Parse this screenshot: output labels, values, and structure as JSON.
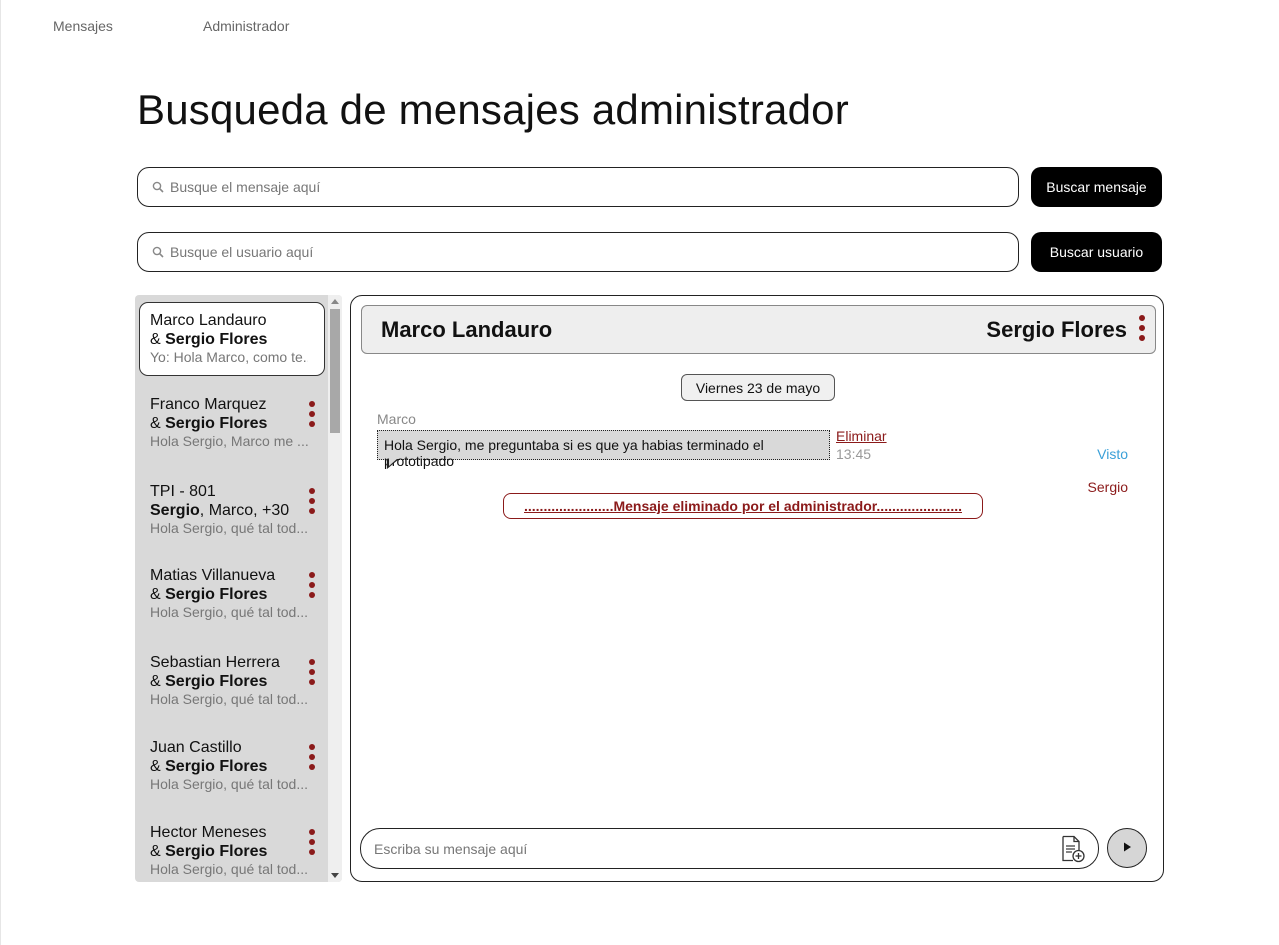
{
  "nav": {
    "mensajes": "Mensajes",
    "administrador": "Administrador"
  },
  "page_title": "Busqueda de mensajes administrador",
  "search_message": {
    "placeholder": "Busque el mensaje aquí",
    "button": "Buscar mensaje"
  },
  "search_user": {
    "placeholder": "Busque el usuario aquí",
    "button": "Buscar usuario"
  },
  "conversations": [
    {
      "l1": "Marco Landauro",
      "amp": "& ",
      "bold": "Sergio Flores",
      "preview": "Yo: Hola Marco, como te..."
    },
    {
      "l1": "Franco Marquez",
      "amp": "& ",
      "bold": "Sergio Flores",
      "preview": "Hola Sergio, Marco me ..."
    },
    {
      "l1": "TPI - 801",
      "bold": "Sergio",
      "rest": ", Marco, +30",
      "preview": "Hola Sergio, qué tal tod..."
    },
    {
      "l1": "Matias Villanueva",
      "amp": "& ",
      "bold": "Sergio Flores",
      "preview": "Hola Sergio, qué tal tod..."
    },
    {
      "l1": "Sebastian Herrera",
      "amp": "& ",
      "bold": "Sergio Flores",
      "preview": "Hola Sergio, qué tal tod..."
    },
    {
      "l1": "Juan Castillo",
      "amp": "& ",
      "bold": "Sergio Flores",
      "preview": "Hola Sergio, qué tal tod..."
    },
    {
      "l1": "Hector Meneses",
      "amp": "& ",
      "bold": "Sergio Flores",
      "preview": "Hola Sergio, qué tal tod..."
    }
  ],
  "chat": {
    "left_name": "Marco Landauro",
    "right_name": "Sergio Flores",
    "date": "Viernes 23 de mayo",
    "sender_marco": "Marco",
    "message": "Hola Sergio, me preguntaba si es que ya habias terminado el prototipado",
    "delete_label": "Eliminar",
    "time": "13:45",
    "seen": "Visto",
    "sender_sergio": "Sergio",
    "deleted_notice": ".......................Mensaje eliminado por el administrador......................"
  },
  "composer": {
    "placeholder": "Escriba su mensaje aquí"
  },
  "colors": {
    "accent_red": "#8b1a1a",
    "seen_blue": "#3aa0d8",
    "button_black": "#000000"
  },
  "icons": {
    "search": "search-icon",
    "more": "more-vertical-icon",
    "attach": "attach-file-icon",
    "send": "send-icon"
  }
}
